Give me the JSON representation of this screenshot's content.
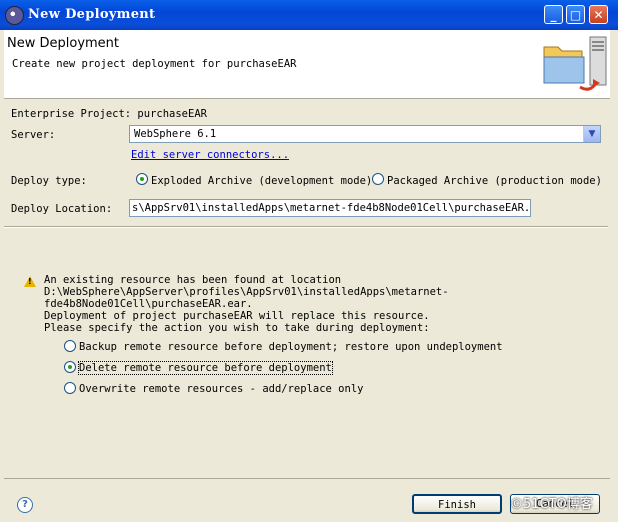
{
  "window": {
    "title": "New Deployment"
  },
  "header": {
    "title": "New Deployment",
    "description": "Create new project deployment for purchaseEAR"
  },
  "form": {
    "enterprise_project": "Enterprise Project: purchaseEAR",
    "server_label": "Server:",
    "server_value": "WebSphere  6.1",
    "edit_link": "Edit server connectors...",
    "deploy_type_label": "Deploy type:",
    "deploy_type_options": [
      "Exploded Archive (development mode)",
      "Packaged Archive (production mode)"
    ],
    "deploy_type_selected": "Exploded Archive (development mode)",
    "deploy_location_label": "Deploy Location:",
    "deploy_location_value": "s\\AppSrv01\\installedApps\\metarnet-fde4b8Node01Cell\\purchaseEAR.ear"
  },
  "warning": {
    "lines": [
      "An existing resource has been found at location",
      "D:\\WebSphere\\AppServer\\profiles\\AppSrv01\\installedApps\\metarnet-",
      "fde4b8Node01Cell\\purchaseEAR.ear.",
      "Deployment of project purchaseEAR will replace this resource.",
      "Please specify the action you wish to take during deployment:"
    ],
    "options": [
      "Backup remote resource before deployment; restore upon undeployment",
      "Delete remote resource before deployment",
      "Overwrite remote resources - add/replace only"
    ],
    "selected": "Delete remote resource before deployment"
  },
  "buttons": {
    "finish": "Finish",
    "cancel": "Cancel"
  },
  "watermark": "©51CTO博客",
  "colors": {
    "titlebar": "#0346d8",
    "dialog_bg": "#ece9d8",
    "link": "#0000d0",
    "radio_selected": "#21a121"
  }
}
